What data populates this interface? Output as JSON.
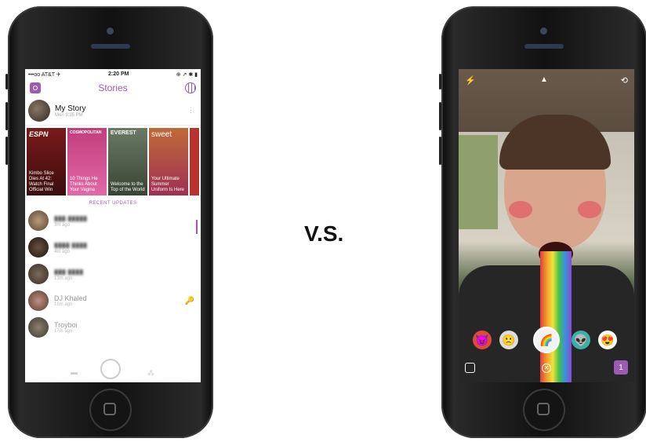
{
  "divider_text": "V.S.",
  "left_phone": {
    "status": {
      "carrier": "•••oo AT&T ✈",
      "time": "2:20 PM",
      "right": "⊕ ↗ ✱ ▮"
    },
    "header": {
      "title": "Stories"
    },
    "my_story": {
      "name": "My Story",
      "time": "Mon 9:25 PM"
    },
    "discover": [
      {
        "brand": "ESPN",
        "caption": "Kimbo Slice Dies At 42: Watch Final Official Win"
      },
      {
        "brand": "COSMOPOLITAN",
        "caption": "10 Things He Thinks About Your Vagina"
      },
      {
        "brand": "EVEREST",
        "caption": "Welcome to the Top of the World"
      },
      {
        "brand": "sweet",
        "caption": "Your Ultimate Summer Uniform Is Here"
      },
      {
        "brand": "",
        "caption": ""
      }
    ],
    "recent_label": "RECENT UPDATES",
    "updates": [
      {
        "name": "",
        "time": "3m ago",
        "key": ""
      },
      {
        "name": "",
        "time": "4m ago",
        "key": ""
      },
      {
        "name": "",
        "time": "13m ago",
        "key": ""
      },
      {
        "name": "DJ Khaled",
        "time": "16m ago",
        "key": "🔑"
      },
      {
        "name": "Troyboi",
        "time": "17m ago",
        "key": ""
      }
    ]
  },
  "right_phone": {
    "lenses": [
      "😈",
      "🙁",
      "🌈",
      "👽",
      "😍"
    ],
    "memories_count": "1",
    "colors": {
      "accent": "#9b5bb4"
    }
  }
}
